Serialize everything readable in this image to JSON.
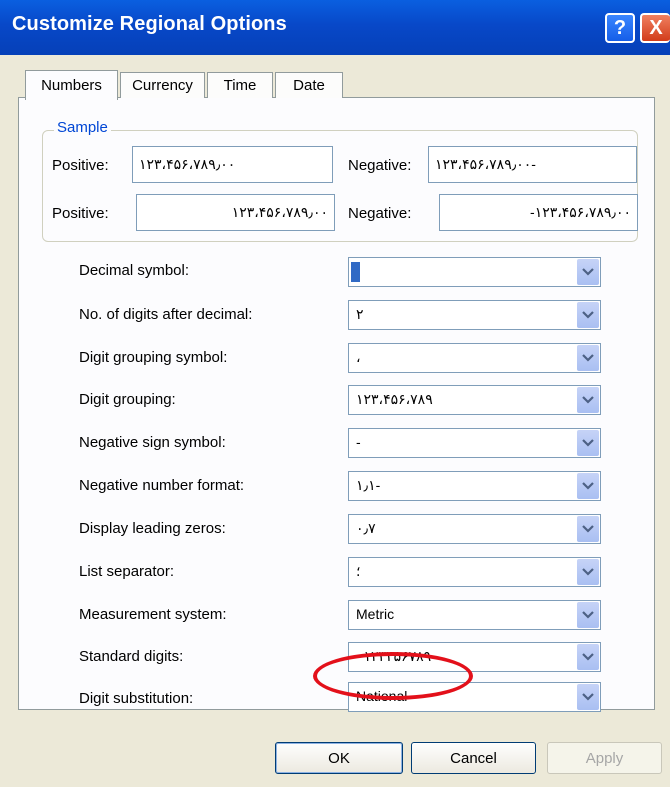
{
  "window": {
    "title": "Customize Regional Options",
    "help_glyph": "?",
    "close_glyph": "X",
    "accent": "#0a5fe0"
  },
  "tabs": [
    {
      "label": "Numbers"
    },
    {
      "label": "Currency"
    },
    {
      "label": "Time"
    },
    {
      "label": "Date"
    }
  ],
  "sample": {
    "group_label": "Sample",
    "row1": {
      "positive_label": "Positive:",
      "positive_value": "۱۲۳،۴۵۶،۷۸۹٫۰۰",
      "negative_label": "Negative:",
      "negative_value": "۱۲۳،۴۵۶،۷۸۹٫۰۰-"
    },
    "row2": {
      "positive_label": "Positive:",
      "positive_value": "۱۲۳،۴۵۶،۷۸۹٫۰۰",
      "negative_label": "Negative:",
      "negative_value": "-۱۲۳،۴۵۶،۷۸۹٫۰۰"
    }
  },
  "settings": [
    {
      "label": "Decimal symbol:",
      "value": ""
    },
    {
      "label": "No. of digits after decimal:",
      "value": "۲"
    },
    {
      "label": "Digit grouping symbol:",
      "value": "،"
    },
    {
      "label": "Digit grouping:",
      "value": "۱۲۳،۴۵۶،۷۸۹"
    },
    {
      "label": "Negative sign symbol:",
      "value": "-"
    },
    {
      "label": "Negative number format:",
      "value": "۱٫۱-"
    },
    {
      "label": "Display leading zeros:",
      "value": "۰٫۷"
    },
    {
      "label": "List separator:",
      "value": "؛"
    },
    {
      "label": "Measurement system:",
      "value": "Metric"
    },
    {
      "label": "Standard digits:",
      "value": "۰۱۲۳۴۵۶۷۸۹"
    },
    {
      "label": "Digit substitution:",
      "value": "National"
    }
  ],
  "buttons": {
    "ok": "OK",
    "cancel": "Cancel",
    "apply": "Apply"
  },
  "annotation": {
    "color": "#e3101a"
  }
}
